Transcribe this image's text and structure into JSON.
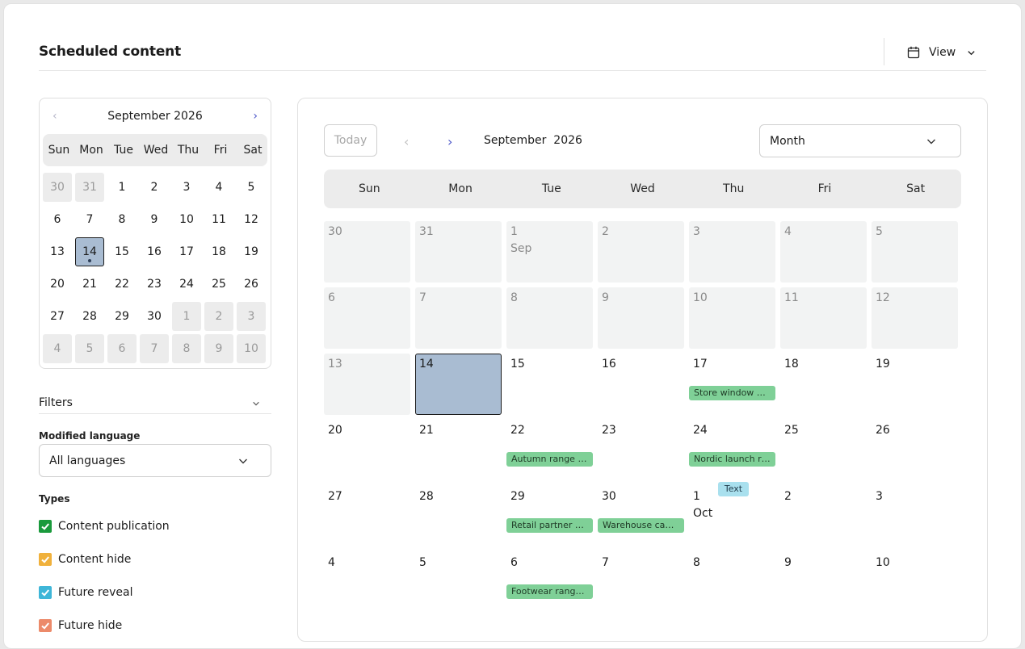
{
  "header": {
    "title": "Scheduled content",
    "view_label": "View"
  },
  "mini_calendar": {
    "month_label": "September 2026",
    "weekdays": [
      "Sun",
      "Mon",
      "Tue",
      "Wed",
      "Thu",
      "Fri",
      "Sat"
    ],
    "days": [
      {
        "label": "30",
        "out": true
      },
      {
        "label": "31",
        "out": true
      },
      {
        "label": "1"
      },
      {
        "label": "2"
      },
      {
        "label": "3"
      },
      {
        "label": "4"
      },
      {
        "label": "5"
      },
      {
        "label": "6"
      },
      {
        "label": "7"
      },
      {
        "label": "8"
      },
      {
        "label": "9"
      },
      {
        "label": "10"
      },
      {
        "label": "11"
      },
      {
        "label": "12"
      },
      {
        "label": "13"
      },
      {
        "label": "14",
        "selected": true
      },
      {
        "label": "15"
      },
      {
        "label": "16"
      },
      {
        "label": "17"
      },
      {
        "label": "18"
      },
      {
        "label": "19"
      },
      {
        "label": "20"
      },
      {
        "label": "21"
      },
      {
        "label": "22"
      },
      {
        "label": "23"
      },
      {
        "label": "24"
      },
      {
        "label": "25"
      },
      {
        "label": "26"
      },
      {
        "label": "27"
      },
      {
        "label": "28"
      },
      {
        "label": "29"
      },
      {
        "label": "30"
      },
      {
        "label": "1",
        "out": true
      },
      {
        "label": "2",
        "out": true
      },
      {
        "label": "3",
        "out": true
      },
      {
        "label": "4",
        "out": true
      },
      {
        "label": "5",
        "out": true
      },
      {
        "label": "6",
        "out": true
      },
      {
        "label": "7",
        "out": true
      },
      {
        "label": "8",
        "out": true
      },
      {
        "label": "9",
        "out": true
      },
      {
        "label": "10",
        "out": true
      }
    ]
  },
  "filters": {
    "label": "Filters",
    "language_label": "Modified language",
    "language_value": "All languages",
    "types_label": "Types",
    "types": [
      {
        "label": "Content publication",
        "color": "#1a9a3c",
        "checked": true
      },
      {
        "label": "Content hide",
        "color": "#f0b13c",
        "checked": true
      },
      {
        "label": "Future reveal",
        "color": "#3fb6d8",
        "checked": true
      },
      {
        "label": "Future hide",
        "color": "#ec8a6a",
        "checked": true
      }
    ]
  },
  "main_calendar": {
    "today_label": "Today",
    "month_label": "September  2026",
    "view_select": "Month",
    "weekdays": [
      "Sun",
      "Mon",
      "Tue",
      "Wed",
      "Thu",
      "Fri",
      "Sat"
    ],
    "cells": [
      {
        "num": "30",
        "past": true
      },
      {
        "num": "31",
        "past": true
      },
      {
        "num": "1",
        "month": "Sep",
        "past": true
      },
      {
        "num": "2",
        "past": true
      },
      {
        "num": "3",
        "past": true
      },
      {
        "num": "4",
        "past": true
      },
      {
        "num": "5",
        "past": true
      },
      {
        "num": "6",
        "past": true
      },
      {
        "num": "7",
        "past": true
      },
      {
        "num": "8",
        "past": true
      },
      {
        "num": "9",
        "past": true
      },
      {
        "num": "10",
        "past": true
      },
      {
        "num": "11",
        "past": true
      },
      {
        "num": "12",
        "past": true
      },
      {
        "num": "13",
        "past": true
      },
      {
        "num": "14",
        "selected": true
      },
      {
        "num": "15"
      },
      {
        "num": "16"
      },
      {
        "num": "17",
        "events": [
          "Store window …"
        ]
      },
      {
        "num": "18"
      },
      {
        "num": "19"
      },
      {
        "num": "20"
      },
      {
        "num": "21"
      },
      {
        "num": "22",
        "events": [
          "Autumn range …"
        ]
      },
      {
        "num": "23"
      },
      {
        "num": "24",
        "events": [
          "Nordic launch r…"
        ]
      },
      {
        "num": "25"
      },
      {
        "num": "26"
      },
      {
        "num": "27"
      },
      {
        "num": "28"
      },
      {
        "num": "29",
        "events": [
          "Retail partner …"
        ]
      },
      {
        "num": "30",
        "events": [
          "Warehouse ca…"
        ]
      },
      {
        "num": "1",
        "month": "Oct",
        "tag": "Text"
      },
      {
        "num": "2"
      },
      {
        "num": "3"
      },
      {
        "num": "4"
      },
      {
        "num": "5"
      },
      {
        "num": "6",
        "events": [
          "Footwear rang…"
        ]
      },
      {
        "num": "7"
      },
      {
        "num": "8"
      },
      {
        "num": "9"
      },
      {
        "num": "10"
      }
    ]
  },
  "colors": {
    "accent": "#4a55c8",
    "selected_day": "#a9bcd2",
    "event_green": "#7fd097",
    "tag_blue": "#a9e0ee"
  }
}
